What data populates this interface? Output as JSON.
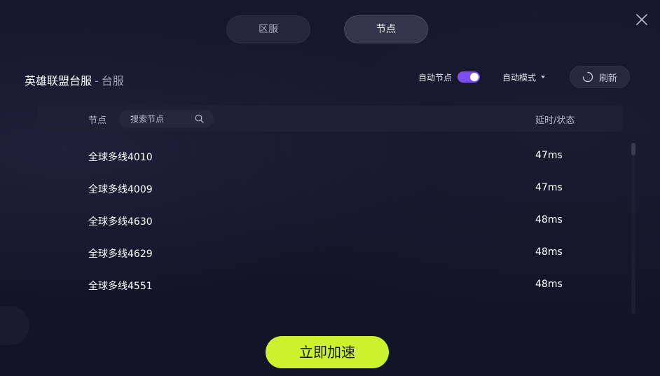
{
  "tabs": [
    {
      "label": "区服",
      "active": false
    },
    {
      "label": "节点",
      "active": true
    }
  ],
  "header": {
    "game_name": "英雄联盟台服",
    "separator": "-",
    "server": "台服"
  },
  "controls": {
    "auto_node_label": "自动节点",
    "auto_node_enabled": true,
    "mode_label": "自动模式",
    "refresh_label": "刷新"
  },
  "list_header": {
    "node_label": "节点",
    "search_placeholder": "搜索节点",
    "latency_label": "延时/状态"
  },
  "nodes": [
    {
      "name": "全球多线4010",
      "latency": "47ms"
    },
    {
      "name": "全球多线4009",
      "latency": "47ms"
    },
    {
      "name": "全球多线4630",
      "latency": "48ms"
    },
    {
      "name": "全球多线4629",
      "latency": "48ms"
    },
    {
      "name": "全球多线4551",
      "latency": "48ms"
    }
  ],
  "action": {
    "accelerate_label": "立即加速"
  },
  "colors": {
    "background": "#14142a",
    "accent_green": "#cbf22c",
    "toggle_purple": "#7f4cf0"
  }
}
